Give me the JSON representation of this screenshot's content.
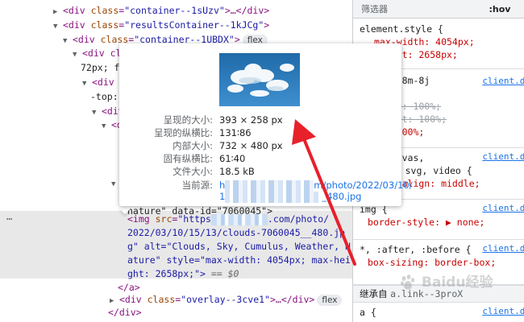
{
  "dom_tree": {
    "lines": [
      {
        "indent": 66,
        "tri": "▶",
        "open": "<div ",
        "attr": "class",
        "val": "\"container--1sUzv\"",
        "rest": ">…</div>"
      },
      {
        "indent": 66,
        "tri": "▼",
        "open": "<div ",
        "attr": "class",
        "val": "\"resultsContainer--1kJCg\"",
        "rest": ">"
      },
      {
        "indent": 78,
        "tri": "▼",
        "open": "<div ",
        "attr": "class",
        "val": "\"container--1UBDX\"",
        "rest": ">",
        "badge": "flex"
      },
      {
        "indent": 90,
        "tri": "▼",
        "open": "<div cla",
        "attr": "",
        "val": "",
        "rest": ""
      },
      {
        "indent": 100,
        "tri": "",
        "open": "",
        "attr": "",
        "val": "",
        "rest": "72px; fl"
      },
      {
        "indent": 102,
        "tri": "▼",
        "open": "<div c",
        "attr": "",
        "val": "",
        "rest": ""
      },
      {
        "indent": 112,
        "tri": "",
        "open": "",
        "attr": "",
        "val": "",
        "rest": "-top:"
      },
      {
        "indent": 114,
        "tri": "▼",
        "open": "<div",
        "attr": "",
        "val": "",
        "rest": ""
      },
      {
        "indent": 126,
        "tri": "▼",
        "open": "<d",
        "attr": "",
        "val": "",
        "rest": ""
      },
      {
        "indent": 0,
        "tri": "",
        "open": "",
        "attr": "",
        "val": "",
        "rest": ""
      },
      {
        "indent": 0,
        "tri": "",
        "open": "",
        "attr": "",
        "val": "",
        "rest": ""
      },
      {
        "indent": 0,
        "tri": "",
        "open": "",
        "attr": "",
        "val": "",
        "rest": ""
      },
      {
        "indent": 138,
        "tri": "▼",
        "open": "",
        "attr": "",
        "val": "",
        "rest": ""
      },
      {
        "indent": 0,
        "tri": "",
        "open": "",
        "attr": "",
        "val": "",
        "rest": ""
      },
      {
        "indent": 158,
        "tri": "",
        "open": "",
        "attr": "",
        "val": "",
        "rest": "nature\"  data-id=\"7060045\">"
      }
    ],
    "ellipsis": "…",
    "selected": {
      "line1_open": "<img ",
      "line1_attr": "src",
      "line1_val": "\"https",
      "line1_tail": ".com/photo/",
      "line2": "2022/03/10/15/13/clouds-7060045__480.jp",
      "line3": "g\" alt=\"Clouds, Sky, Cumulus, Weather, N",
      "line4": "ature\" style=\"max-width: 4054px; max-hei",
      "line5": "ght: 2658px;\">",
      "dollar": " == $0"
    },
    "close_a": "</a>",
    "overlay_open": "<div ",
    "overlay_attr": "class",
    "overlay_val": "\"overlay--3cve1\"",
    "overlay_rest": ">…</div>",
    "overlay_badge": "flex",
    "close_div": "</div>"
  },
  "styles_panel": {
    "filter_placeholder": "筛选器",
    "hov_label": ":hov",
    "rules": {
      "element_selector": "element.style {",
      "element_prop1": "max-width: 4054px;",
      "element_prop2": "height: 2658px;",
      "r2_selector": "ner--8m-8j",
      "r2_src": "client.de",
      "r2_prop1": "width: 100%;",
      "r2_prop2": "height: 100%;",
      "r2_prop3": "ht: 100%;",
      "r3_selector": ", canvas,",
      "r3_src": "client.de",
      "r3_line2": "img, svg, video {",
      "r3_prop": "ical-align: middle;",
      "r4_selector": "img {",
      "r4_src": "client.de",
      "r4_prop": "border-style: ▶ none;",
      "r5_selector": "*, :after, :before {",
      "r5_src": "client.de",
      "r5_prop": "box-sizing: border-box;",
      "inherit_label": "继承自",
      "inherit_class": "a.link--3proX",
      "r6_selector": "a {",
      "r6_src": "client.de"
    }
  },
  "tooltip": {
    "rows": [
      {
        "key": "呈现的大小:",
        "value": "393 × 258 px"
      },
      {
        "key": "呈现的纵横比:",
        "value": "131∶86"
      },
      {
        "key": "内部大小:",
        "value": "732 × 480 px"
      },
      {
        "key": "固有纵横比:",
        "value": "61∶40"
      },
      {
        "key": "文件大小:",
        "value": "18.5 kB"
      }
    ],
    "source_key": "当前源:",
    "source_line1_a": "h",
    "source_line1_b": "m/photo/2022/03/10/",
    "source_line2_a": "1",
    "source_line2_b": "_480.jpg"
  },
  "watermark": "Baidu经验",
  "colors": {
    "arrow": "#e8202a",
    "tag": "#881280",
    "attr_name": "#994500",
    "attr_value": "#1a1aa6",
    "link": "#1a73e8"
  }
}
